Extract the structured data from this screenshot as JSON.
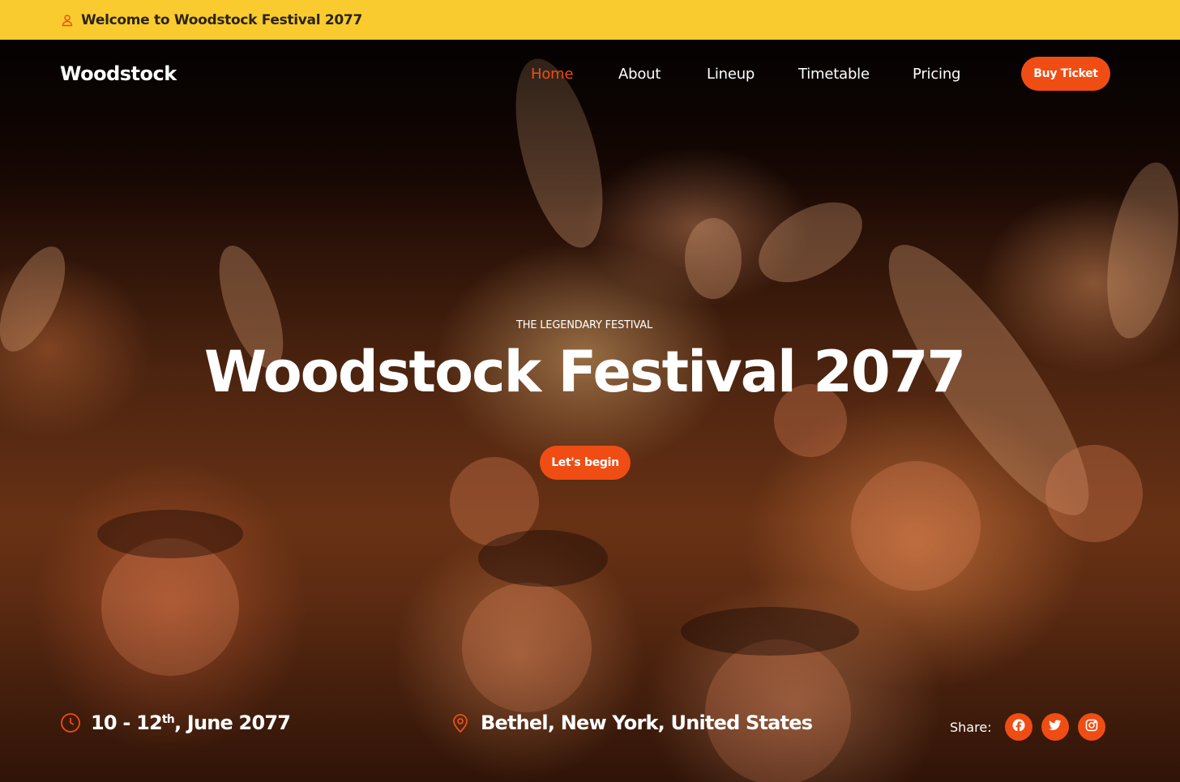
{
  "topbar": {
    "welcome": "Welcome to Woodstock Festival 2077",
    "icon": "user-icon"
  },
  "nav": {
    "logo": "Woodstock",
    "items": [
      {
        "label": "Home",
        "active": true
      },
      {
        "label": "About"
      },
      {
        "label": "Lineup"
      },
      {
        "label": "Timetable"
      },
      {
        "label": "Pricing"
      }
    ],
    "cta": "Buy Ticket"
  },
  "hero": {
    "eyebrow": "THE LEGENDARY FESTIVAL",
    "title": "Woodstock Festival 2077",
    "button": "Let's begin"
  },
  "event": {
    "date_prefix": "10 - 12",
    "date_sup": "th",
    "date_suffix": ", June 2077",
    "location": "Bethel, New York, United States"
  },
  "share": {
    "label": "Share:",
    "networks": [
      "facebook-icon",
      "twitter-icon",
      "instagram-icon"
    ]
  },
  "colors": {
    "accent": "#ef4d14",
    "topbar": "#f9cb2f"
  }
}
